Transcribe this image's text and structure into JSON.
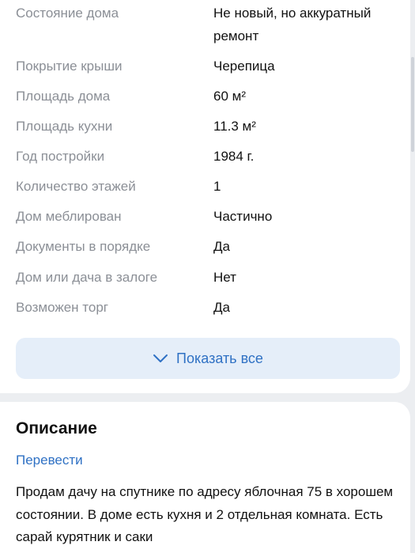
{
  "details": {
    "rows": [
      {
        "label": "Состояние дома",
        "value": "Не новый, но аккуратный ремонт"
      },
      {
        "label": "Покрытие крыши",
        "value": "Черепица"
      },
      {
        "label": "Площадь дома",
        "value": "60 м²"
      },
      {
        "label": "Площадь кухни",
        "value": "11.3 м²"
      },
      {
        "label": "Год постройки",
        "value": "1984 г."
      },
      {
        "label": "Количество этажей",
        "value": "1"
      },
      {
        "label": "Дом меблирован",
        "value": "Частично"
      },
      {
        "label": "Документы в порядке",
        "value": "Да"
      },
      {
        "label": "Дом или дача в залоге",
        "value": "Нет"
      },
      {
        "label": "Возможен торг",
        "value": "Да"
      }
    ],
    "show_all_label": "Показать все",
    "show_all_icon": "chevron-down-icon"
  },
  "description": {
    "title": "Описание",
    "translate_label": "Перевести",
    "text": "Продам дачу на спутнике по адресу яблочная 75 в хорошем состоянии. В доме есть кухня и 2 отдельная комната. Есть сарай курятник и саки"
  },
  "colors": {
    "accent": "#2f71c4",
    "button_bg": "#e5eef9",
    "label": "#8b8f96",
    "background": "#eceef1"
  }
}
